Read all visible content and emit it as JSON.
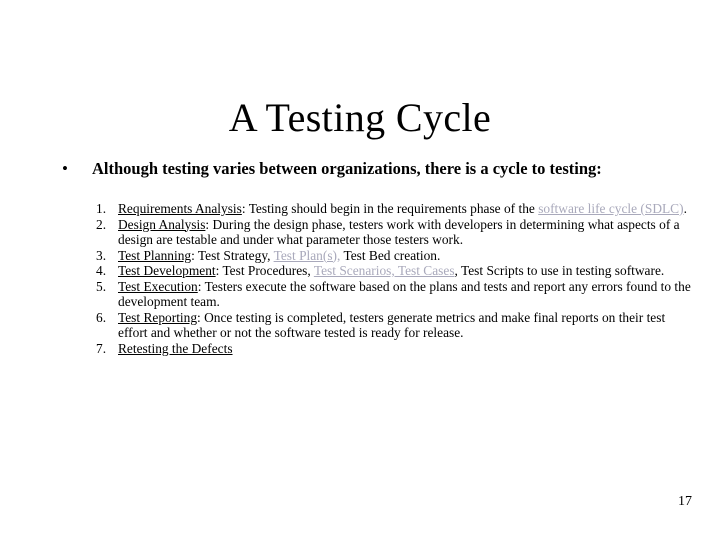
{
  "slide": {
    "title": "A Testing Cycle",
    "page_number": "17",
    "bullet": {
      "marker": "•",
      "text": "Although testing varies between organizations, there is a cycle to testing:"
    },
    "link_color": "#a9a9bb",
    "text_color": "#000000",
    "background_color": "#ffffff"
  },
  "list": {
    "items": [
      {
        "number": "1.",
        "heading": "Requirements Analysis",
        "sep": ": ",
        "body_1": "Testing should begin in the requirements phase of the ",
        "link": "software life cycle (SDLC)",
        "body_2": "."
      },
      {
        "number": "2.",
        "heading": "Design Analysis",
        "sep": ": ",
        "body_1": "During the design phase, testers work with developers in determining what aspects of a design are testable and under what parameter those testers work.",
        "link": "",
        "body_2": ""
      },
      {
        "number": "3.",
        "heading": "Test Planning",
        "sep": ": ",
        "body_1": "Test Strategy, ",
        "link": "Test Plan(s),",
        "body_2": " Test Bed creation."
      },
      {
        "number": "4.",
        "heading": "Test Development",
        "sep": ": ",
        "body_1": "Test Procedures, ",
        "link": "Test Scenarios, Test Cases",
        "body_2": ", Test Scripts to use in testing software."
      },
      {
        "number": "5.",
        "heading": "Test Execution",
        "sep": ": ",
        "body_1": "Testers execute the software based on the plans and tests and report any errors found to the development team.",
        "link": "",
        "body_2": ""
      },
      {
        "number": "6.",
        "heading": "Test Reporting",
        "sep": ": ",
        "body_1": "Once testing is completed, testers generate metrics and make final reports on their test effort and whether or not the software tested is ready for release.",
        "link": "",
        "body_2": ""
      },
      {
        "number": "7.",
        "heading": "Retesting the Defects",
        "sep": "",
        "body_1": "",
        "link": "",
        "body_2": ""
      }
    ]
  }
}
